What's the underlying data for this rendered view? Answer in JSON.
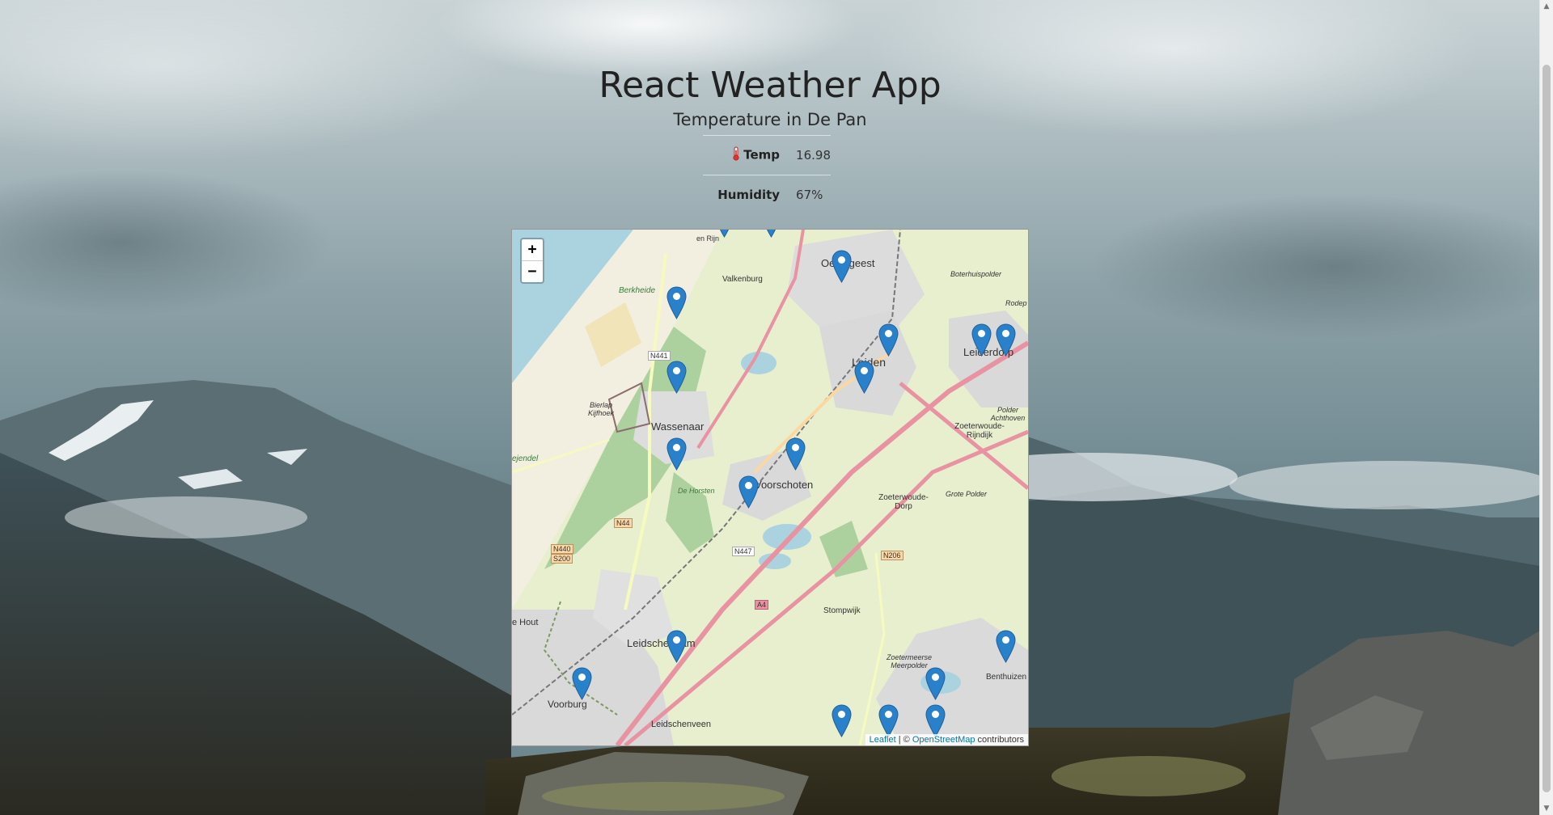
{
  "app": {
    "title": "React Weather App",
    "subtitle": "Temperature in De Pan"
  },
  "stats": [
    {
      "label": "Temp",
      "value": "16.98",
      "icon": "thermometer-icon"
    },
    {
      "label": "Humidity",
      "value": "67%"
    }
  ],
  "map": {
    "zoom_in": "+",
    "zoom_out": "−",
    "attribution": {
      "leaflet": "Leaflet",
      "separator": " | © ",
      "osm": "OpenStreetMap",
      "contributors": " contributors"
    },
    "places": [
      {
        "name": "Oegstgeest",
        "size": "big"
      },
      {
        "name": "Valkenburg",
        "size": "small"
      },
      {
        "name": "Berkheide",
        "size": "small"
      },
      {
        "name": "Leiden",
        "size": "big"
      },
      {
        "name": "Leiderdorp",
        "size": "big"
      },
      {
        "name": "Wassenaar",
        "size": "big"
      },
      {
        "name": "Voorschoten",
        "size": "big"
      },
      {
        "name": "Zoeterwoude-Rijndijk",
        "size": "small"
      },
      {
        "name": "Zoeterwoude-Dorp",
        "size": "small"
      },
      {
        "name": "Leidschendam",
        "size": "big"
      },
      {
        "name": "Voorburg",
        "size": "big"
      },
      {
        "name": "Leidschenveen",
        "size": "small"
      },
      {
        "name": "Stompwijk",
        "size": "small"
      },
      {
        "name": "Benthuizen",
        "size": "small"
      },
      {
        "name": "Bierlap Kijfhoek",
        "size": "small"
      },
      {
        "name": "De Horsten",
        "size": "small"
      },
      {
        "name": "Grote Polder",
        "size": "small"
      },
      {
        "name": "Boterhuispolder",
        "size": "small"
      },
      {
        "name": "Rodep",
        "size": "small"
      },
      {
        "name": "Polder Achthoven",
        "size": "small"
      },
      {
        "name": "Zoetermeerse Meerpolder",
        "size": "small"
      },
      {
        "name": "e Hout",
        "size": "small"
      },
      {
        "name": "ejendel",
        "size": "small"
      },
      {
        "name": "en Rijn",
        "size": "small"
      }
    ],
    "road_labels": [
      "N441",
      "N44",
      "N440",
      "S200",
      "N447",
      "N206",
      "A4"
    ],
    "marker_count": 19,
    "colors": {
      "marker": "#2a81cb",
      "water": "#aad3df",
      "land": "#e8efcf",
      "forest": "#add19e",
      "motorway": "#e892a2"
    }
  }
}
